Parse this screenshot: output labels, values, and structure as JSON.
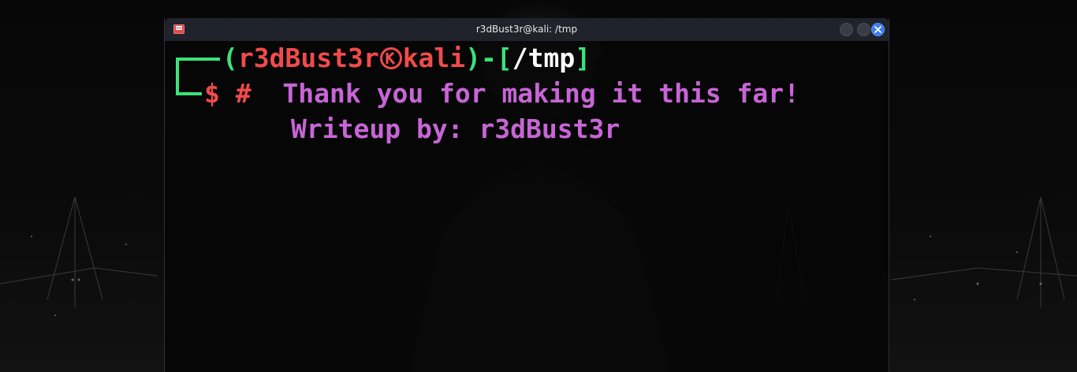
{
  "window": {
    "title": "r3dBust3r@kali: /tmp"
  },
  "prompt": {
    "open_paren": "(",
    "user": "r3dBust3r",
    "host": "kali",
    "close_paren": ")",
    "dash": "-",
    "open_bracket": "[",
    "cwd": "/tmp",
    "close_bracket": "]",
    "symbol": "$",
    "hash": "#"
  },
  "output": {
    "line1": "Thank you for making it this far!",
    "line2": "Writeup by: r3dBust3r"
  },
  "colors": {
    "green": "#3ce27a",
    "red": "#f04b4b",
    "purple": "#c765d6",
    "titlebar": "#20232b",
    "close_button": "#3b7bf0"
  },
  "icons": {
    "app": "terminal-app-icon",
    "kali": "kali-symbol-icon",
    "close": "close-icon"
  }
}
